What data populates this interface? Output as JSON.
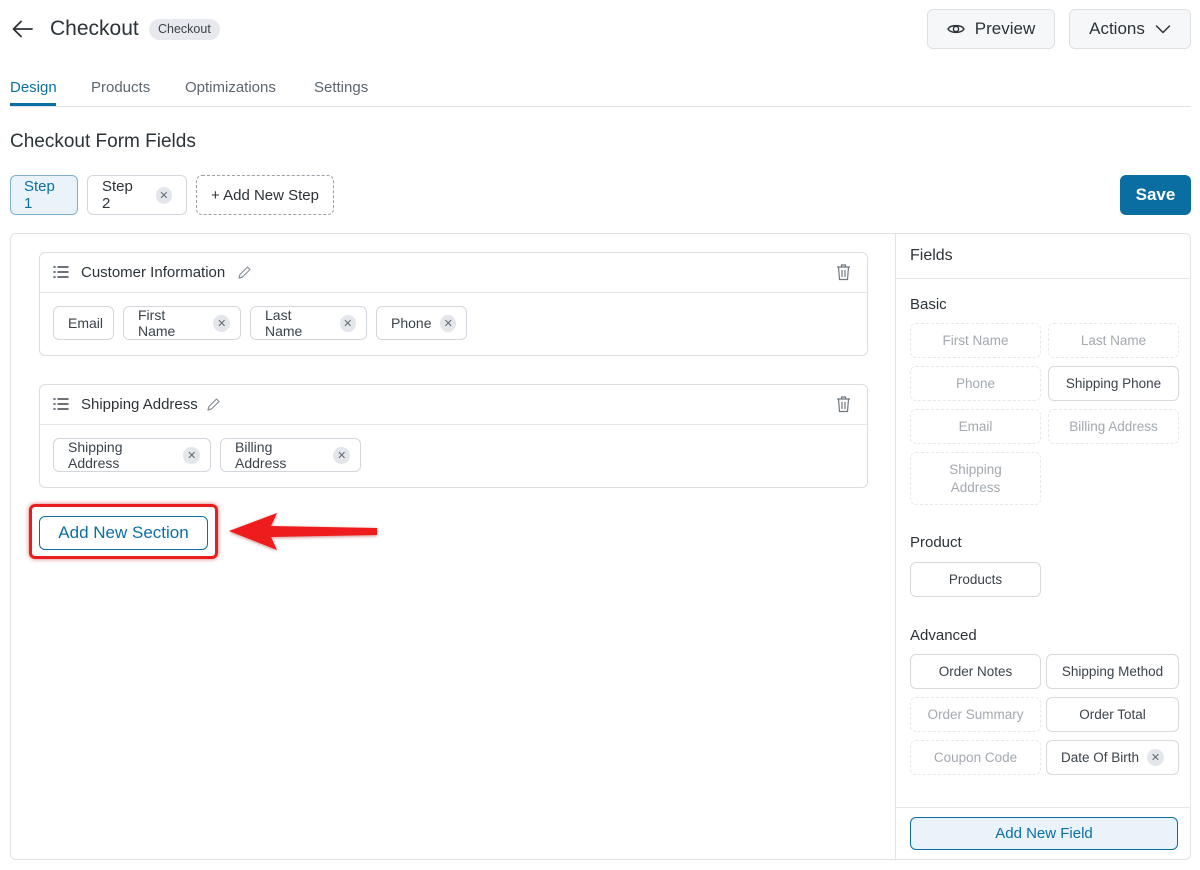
{
  "header": {
    "title": "Checkout",
    "badge": "Checkout",
    "preview_label": "Preview",
    "actions_label": "Actions"
  },
  "tabs": [
    {
      "label": "Design",
      "active": true
    },
    {
      "label": "Products",
      "active": false
    },
    {
      "label": "Optimizations",
      "active": false
    },
    {
      "label": "Settings",
      "active": false
    }
  ],
  "page_title": "Checkout Form Fields",
  "steps": {
    "step1": "Step 1",
    "step2": "Step 2",
    "add_step": "+ Add New Step",
    "save": "Save"
  },
  "sections": [
    {
      "title": "Customer Information",
      "fields": [
        {
          "label": "Email",
          "removable": false
        },
        {
          "label": "First Name",
          "removable": true
        },
        {
          "label": "Last Name",
          "removable": true
        },
        {
          "label": "Phone",
          "removable": true
        }
      ]
    },
    {
      "title": "Shipping Address",
      "fields": [
        {
          "label": "Shipping Address",
          "removable": true
        },
        {
          "label": "Billing Address",
          "removable": true
        }
      ]
    }
  ],
  "add_section_label": "Add New Section",
  "sidebar": {
    "title": "Fields",
    "groups": {
      "basic": {
        "label": "Basic",
        "items": [
          {
            "label": "First Name",
            "used": true
          },
          {
            "label": "Last Name",
            "used": true
          },
          {
            "label": "Phone",
            "used": true
          },
          {
            "label": "Shipping Phone",
            "used": false
          },
          {
            "label": "Email",
            "used": true
          },
          {
            "label": "Billing Address",
            "used": true
          },
          {
            "label": "Shipping Address",
            "used": true
          }
        ]
      },
      "product": {
        "label": "Product",
        "items": [
          {
            "label": "Products",
            "used": false
          }
        ]
      },
      "advanced": {
        "label": "Advanced",
        "items": [
          {
            "label": "Order Notes",
            "used": false
          },
          {
            "label": "Shipping Method",
            "used": false
          },
          {
            "label": "Order Summary",
            "used": true
          },
          {
            "label": "Order Total",
            "used": false
          },
          {
            "label": "Coupon Code",
            "used": true
          },
          {
            "label": "Date Of Birth",
            "used": false
          }
        ]
      }
    },
    "add_field_label": "Add New Field"
  },
  "colors": {
    "accent": "#0a6ea3",
    "highlight": "#e81e1e"
  },
  "icons": [
    "back-arrow-icon",
    "eye-icon",
    "chevron-down-icon",
    "close-icon",
    "drag-list-icon",
    "pencil-icon",
    "trash-icon",
    "red-arrow-icon"
  ]
}
